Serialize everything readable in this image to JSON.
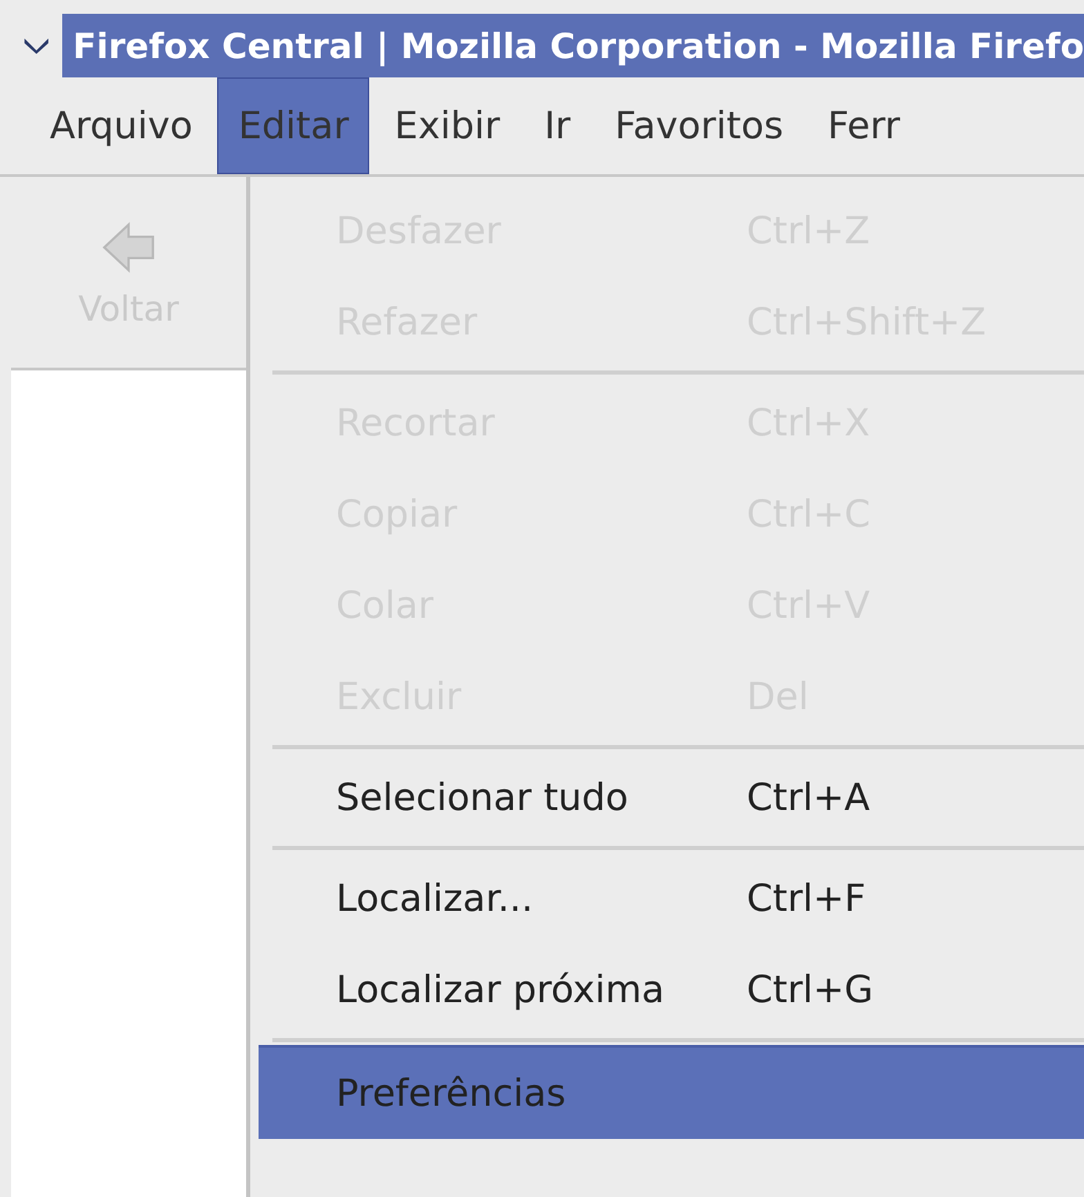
{
  "window": {
    "title": "Firefox Central | Mozilla Corporation - Mozilla Firefo"
  },
  "menubar": [
    {
      "label": "Arquivo",
      "selected": false
    },
    {
      "label": "Editar",
      "selected": true
    },
    {
      "label": "Exibir",
      "selected": false
    },
    {
      "label": "Ir",
      "selected": false
    },
    {
      "label": "Favoritos",
      "selected": false
    },
    {
      "label": "Ferr",
      "selected": false
    }
  ],
  "toolbar": {
    "back_button": {
      "label": "Voltar",
      "disabled": true
    }
  },
  "menu": [
    {
      "kind": "item",
      "label": "Desfazer",
      "shortcut": "Ctrl+Z",
      "disabled": true,
      "selected": false
    },
    {
      "kind": "item",
      "label": "Refazer",
      "shortcut": "Ctrl+Shift+Z",
      "disabled": true,
      "selected": false
    },
    {
      "kind": "separator"
    },
    {
      "kind": "item",
      "label": "Recortar",
      "shortcut": "Ctrl+X",
      "disabled": true,
      "selected": false
    },
    {
      "kind": "item",
      "label": "Copiar",
      "shortcut": "Ctrl+C",
      "disabled": true,
      "selected": false
    },
    {
      "kind": "item",
      "label": "Colar",
      "shortcut": "Ctrl+V",
      "disabled": true,
      "selected": false
    },
    {
      "kind": "item",
      "label": "Excluir",
      "shortcut": "Del",
      "disabled": true,
      "selected": false
    },
    {
      "kind": "separator"
    },
    {
      "kind": "item",
      "label": "Selecionar tudo",
      "shortcut": "Ctrl+A",
      "disabled": false,
      "selected": false
    },
    {
      "kind": "separator"
    },
    {
      "kind": "item",
      "label": "Localizar...",
      "shortcut": "Ctrl+F",
      "disabled": false,
      "selected": false
    },
    {
      "kind": "item",
      "label": "Localizar próxima",
      "shortcut": "Ctrl+G",
      "disabled": false,
      "selected": false
    },
    {
      "kind": "separator"
    },
    {
      "kind": "item",
      "label": "Preferências",
      "disabled": false,
      "selected": true
    }
  ]
}
